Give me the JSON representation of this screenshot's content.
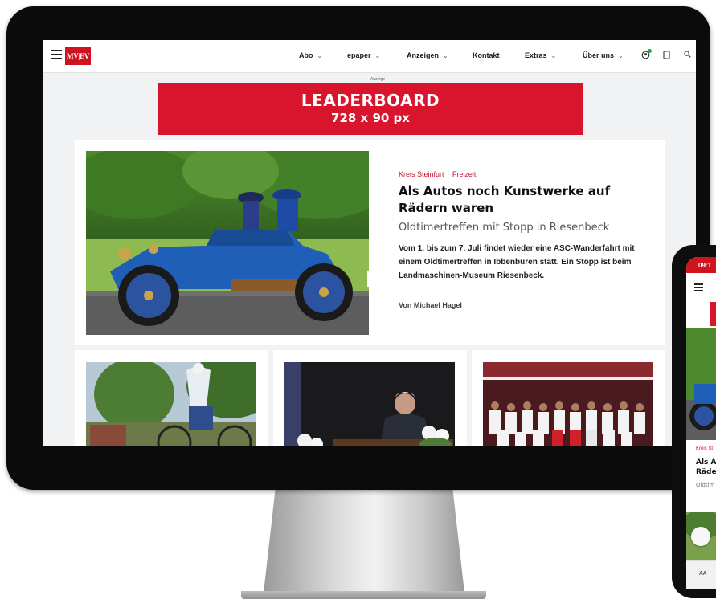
{
  "brand": {
    "logo_text": "MV|EV",
    "accent": "#d0141f",
    "ad_red": "#d9142d"
  },
  "nav": {
    "items": [
      {
        "label": "Abo",
        "has_dropdown": true
      },
      {
        "label": "epaper",
        "has_dropdown": true
      },
      {
        "label": "Anzeigen",
        "has_dropdown": true
      },
      {
        "label": "Kontakt",
        "has_dropdown": false
      },
      {
        "label": "Extras",
        "has_dropdown": true
      },
      {
        "label": "Über uns",
        "has_dropdown": true
      }
    ],
    "icons": [
      "hamburger-icon",
      "user-icon",
      "tablet-icon",
      "search-icon"
    ]
  },
  "ad": {
    "label": "Anzeige",
    "line1": "LEADERBOARD",
    "line2": "728 x 90 px"
  },
  "hero": {
    "kicker_region": "Kreis Steinfurt",
    "kicker_topic": "Freizeit",
    "headline": "Als Autos noch Kunstwerke auf Rädern waren",
    "subheadline": "Oldtimertreffen mit Stopp in Riesenbeck",
    "teaser": "Vom 1. bis zum 7. Juli findet wieder eine ASC-Wanderfahrt mit einem Oldtimertreffen in Ibbenbüren statt. Ein Stopp ist beim Landmaschinen-Museum Riesenbeck.",
    "byline": "Von Michael Hagel"
  },
  "phone": {
    "time": "09:1",
    "kicker": "Kreis St",
    "headline_line1": "Als Au",
    "headline_line2": "Räde",
    "sub": "Oldtim",
    "toolbar_label": "AA"
  }
}
